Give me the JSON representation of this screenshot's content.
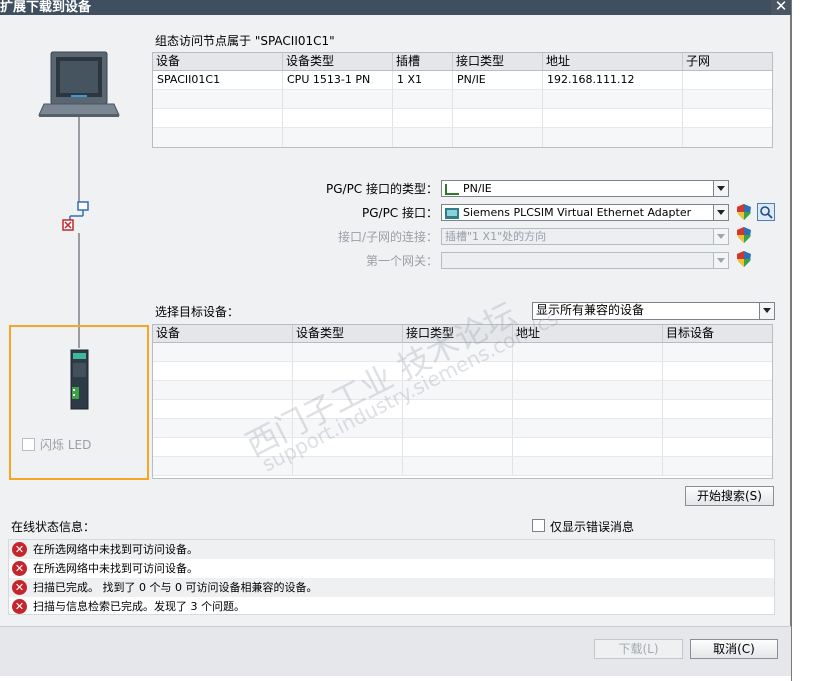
{
  "window": {
    "title": "扩展下载到设备",
    "close_glyph": "✕"
  },
  "config_access": {
    "heading": "组态访问节点属于 \"SPACII01C1\"",
    "columns": [
      "设备",
      "设备类型",
      "插槽",
      "接口类型",
      "地址",
      "子网"
    ],
    "rows": [
      [
        "SPACII01C1",
        "CPU 1513-1 PN",
        "1 X1",
        "PN/IE",
        "192.168.111.12",
        ""
      ]
    ]
  },
  "interface": {
    "type_label": "PG/PC 接口的类型：",
    "type_value": "PN/IE",
    "iface_label": "PG/PC 接口：",
    "iface_value": "Siemens PLCSIM Virtual Ethernet Adapter",
    "conn_label": "接口/子网的连接：",
    "conn_value": "插槽\"1 X1\"处的方向",
    "gateway_label": "第一个网关：",
    "gateway_value": ""
  },
  "target": {
    "label": "选择目标设备：",
    "filter_value": "显示所有兼容的设备",
    "columns": [
      "设备",
      "设备类型",
      "接口类型",
      "地址",
      "目标设备"
    ],
    "empty_rows": 7
  },
  "left_panel": {
    "flash_led_label": "闪烁 LED"
  },
  "search_button": "开始搜索(S)",
  "status": {
    "label": "在线状态信息：",
    "errors_only_label": "仅显示错误消息",
    "messages": [
      "在所选网络中未找到可访问设备。",
      "在所选网络中未找到可访问设备。",
      "扫描已完成。 找到了 0 个与 0 可访问设备相兼容的设备。",
      "扫描与信息检索已完成。发现了 3 个问题。"
    ]
  },
  "footer": {
    "download_label": "下载(L)",
    "cancel_label": "取消(C)"
  },
  "watermark": {
    "line1": "西门子工业 技术论坛",
    "line2": "support.industry.siemens.com/cs"
  },
  "colors": {
    "titlebar": "#3f4f5f",
    "selection_frame": "#f5a623",
    "error": "#c4262e",
    "link_line": "#9a9da3"
  }
}
